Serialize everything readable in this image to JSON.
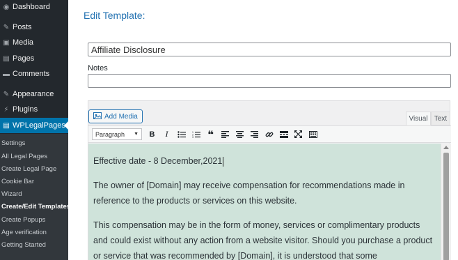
{
  "sidebar": {
    "items": [
      {
        "label": "Dashboard",
        "icon": "dashboard-icon",
        "glyph": "◉"
      },
      {
        "label": "Posts",
        "icon": "pin-icon",
        "glyph": "✎"
      },
      {
        "label": "Media",
        "icon": "media-icon",
        "glyph": "▣"
      },
      {
        "label": "Pages",
        "icon": "pages-icon",
        "glyph": "▤"
      },
      {
        "label": "Comments",
        "icon": "comments-icon",
        "glyph": "▬"
      },
      {
        "label": "Appearance",
        "icon": "appearance-icon",
        "glyph": "✎"
      },
      {
        "label": "Plugins",
        "icon": "plugins-icon",
        "glyph": "⚡"
      },
      {
        "label": "WPLegalPages",
        "icon": "wplegalpages-icon",
        "glyph": "▤"
      }
    ],
    "submenu": [
      "Settings",
      "All Legal Pages",
      "Create Legal Page",
      "Cookie Bar",
      "Wizard",
      "Create/Edit Templates",
      "Create Popups",
      "Age verification",
      "Getting Started"
    ]
  },
  "main": {
    "heading": "Edit Template:",
    "title_value": "Affiliate Disclosure",
    "notes_label": "Notes",
    "notes_value": "",
    "add_media_label": "Add Media",
    "tabs": {
      "visual": "Visual",
      "text": "Text"
    },
    "format_select": "Paragraph",
    "content": [
      "Effective date - 8 December,2021",
      "The owner of [Domain] may receive compensation for recommendations made in reference to the products or services on this website.",
      "This compensation may be in the form of money, services or complimentary products and could exist without any action from a website visitor. Should you purchase a product or service that was recommended by [Domain], it is understood that some"
    ]
  },
  "colors": {
    "sidebar_bg": "#23282d",
    "submenu_bg": "#32373c",
    "active_bg": "#0073aa",
    "heading": "#2271b1",
    "editor_bg": "#cfe3da"
  }
}
